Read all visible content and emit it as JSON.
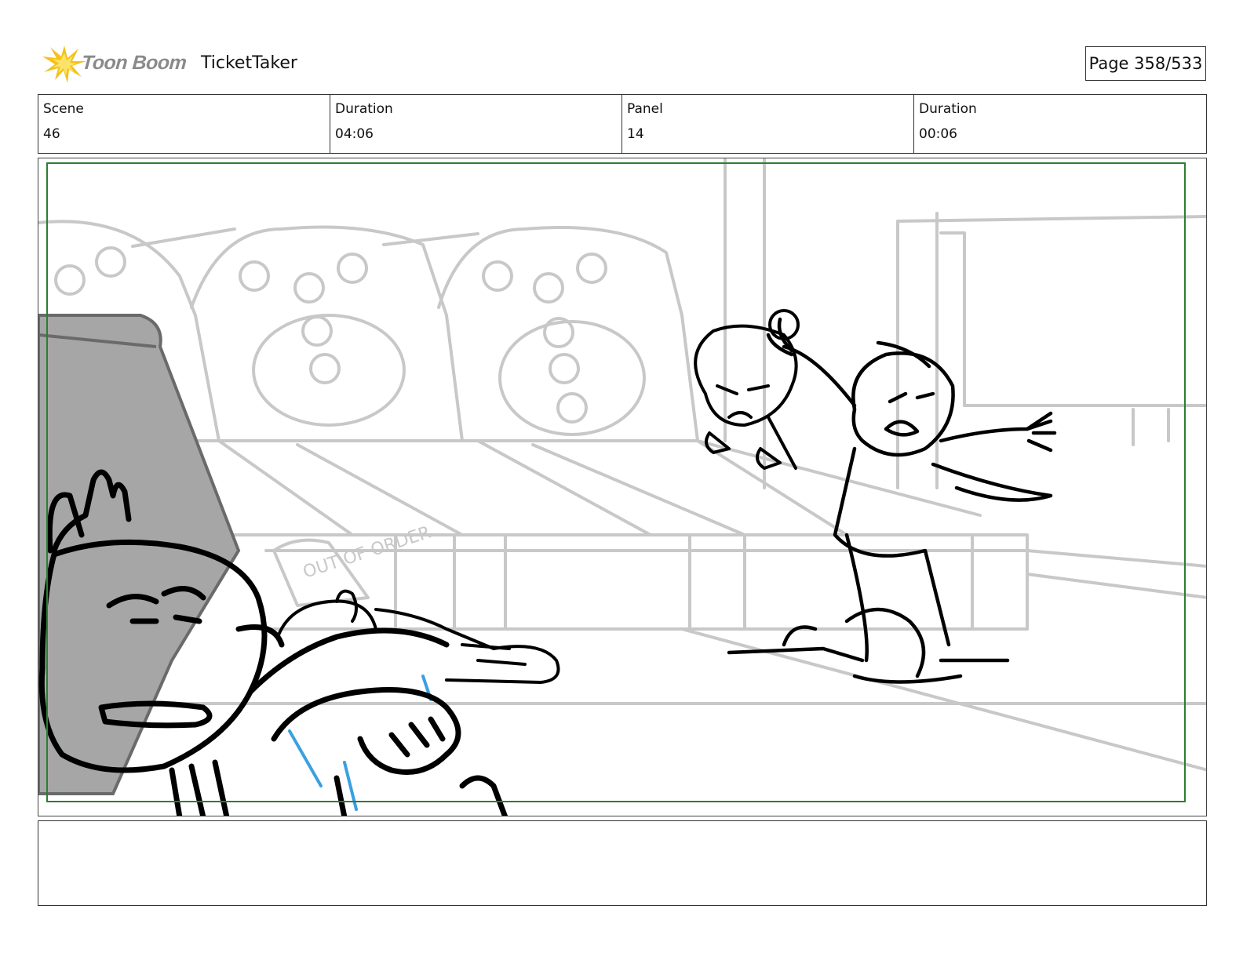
{
  "header": {
    "logo_text": "Toon Boom",
    "project_title": "TicketTaker",
    "page_label": "Page 358/533"
  },
  "info": {
    "scene_label": "Scene",
    "scene_value": "46",
    "scene_duration_label": "Duration",
    "scene_duration_value": "04:06",
    "panel_label": "Panel",
    "panel_value": "14",
    "panel_duration_label": "Duration",
    "panel_duration_value": "00:06"
  },
  "panel": {
    "sign_text": "OUT OF ORDER"
  },
  "caption": {
    "text": ""
  },
  "colors": {
    "safe_frame": "#2e7d32",
    "background_sketch": "#c8c8c8",
    "character_ink": "#000000",
    "accent_blue": "#3aa0e0"
  }
}
